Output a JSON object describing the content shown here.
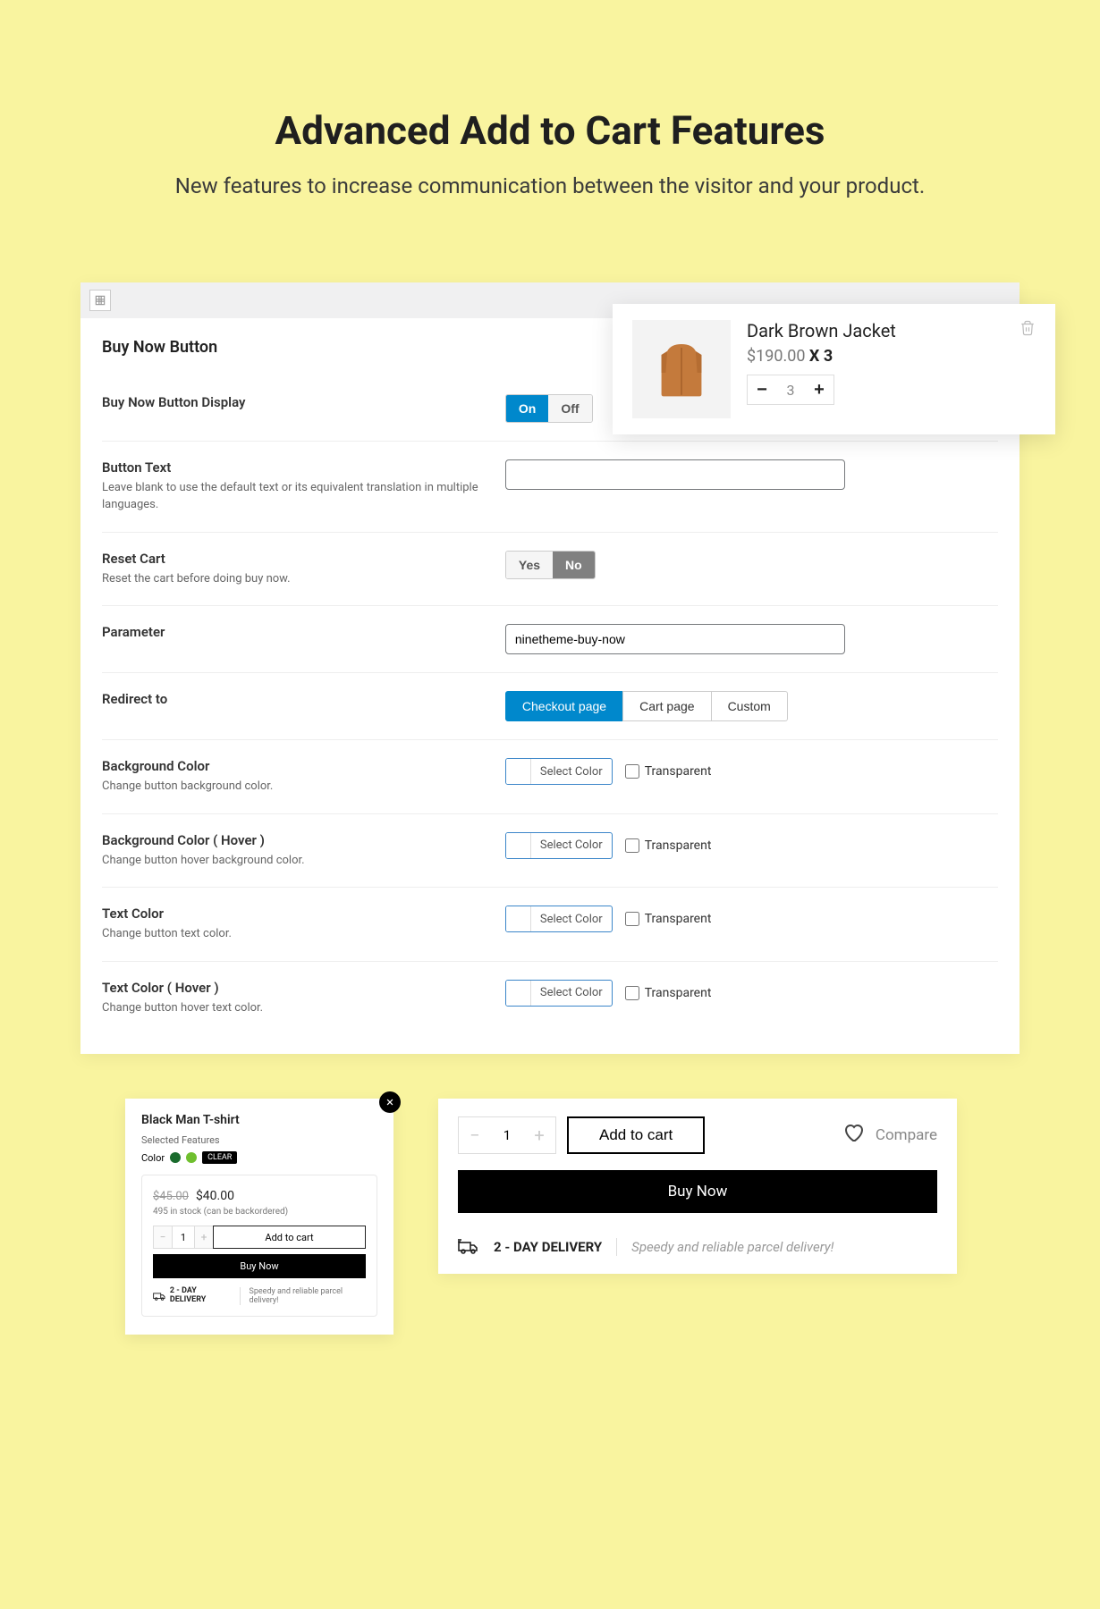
{
  "hero": {
    "title": "Advanced Add to Cart Features",
    "subtitle": "New features to increase communication between the visitor and your product."
  },
  "cart_popup": {
    "title": "Dark Brown Jacket",
    "price": "$190.00",
    "multiplier": "X 3",
    "quantity": "3"
  },
  "settings": {
    "section_title": "Buy Now Button",
    "display": {
      "label": "Buy Now Button Display",
      "on": "On",
      "off": "Off"
    },
    "button_text": {
      "label": "Button Text",
      "desc": "Leave blank to use the default text or its equivalent translation in multiple languages.",
      "value": ""
    },
    "reset_cart": {
      "label": "Reset Cart",
      "desc": "Reset the cart before doing buy now.",
      "yes": "Yes",
      "no": "No"
    },
    "parameter": {
      "label": "Parameter",
      "value": "ninetheme-buy-now"
    },
    "redirect": {
      "label": "Redirect to",
      "opt1": "Checkout page",
      "opt2": "Cart page",
      "opt3": "Custom"
    },
    "bg_color": {
      "label": "Background Color",
      "desc": "Change button background color.",
      "select": "Select Color",
      "transparent": "Transparent"
    },
    "bg_color_hover": {
      "label": "Background Color ( Hover )",
      "desc": "Change button hover background color.",
      "select": "Select Color",
      "transparent": "Transparent"
    },
    "text_color": {
      "label": "Text Color",
      "desc": "Change button text color.",
      "select": "Select Color",
      "transparent": "Transparent"
    },
    "text_color_hover": {
      "label": "Text Color ( Hover )",
      "desc": "Change button hover text color.",
      "select": "Select Color",
      "transparent": "Transparent"
    }
  },
  "preview_a": {
    "title": "Black Man T-shirt",
    "selected_features": "Selected Features",
    "color_label": "Color",
    "clear": "CLEAR",
    "price_old": "$45.00",
    "price_new": "$40.00",
    "stock": "495 in stock (can be backordered)",
    "qty": "1",
    "add_to_cart": "Add to cart",
    "buy_now": "Buy Now",
    "delivery_label": "2 - DAY DELIVERY",
    "delivery_desc": "Speedy and reliable parcel delivery!"
  },
  "preview_b": {
    "qty": "1",
    "add_to_cart": "Add to cart",
    "compare": "Compare",
    "buy_now": "Buy Now",
    "delivery_label": "2 - DAY DELIVERY",
    "delivery_desc": "Speedy and reliable parcel delivery!"
  }
}
